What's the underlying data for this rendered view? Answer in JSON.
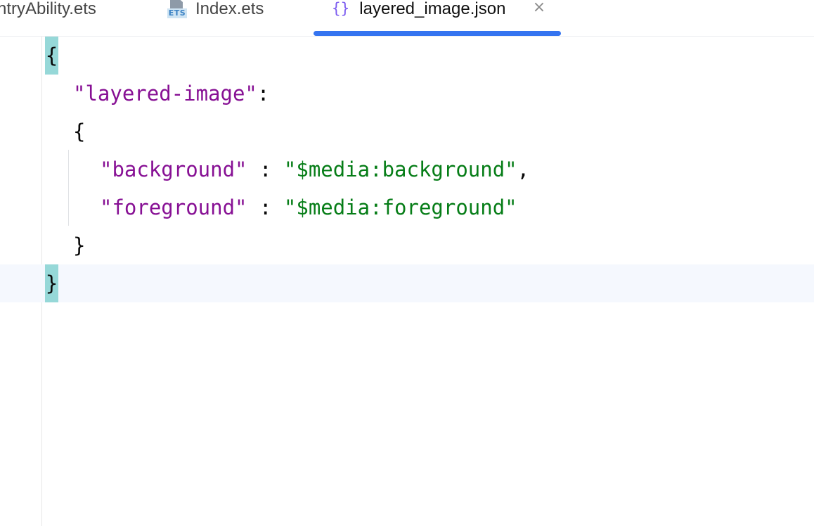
{
  "tabs": [
    {
      "label": "ntryAbility.ets",
      "active": false
    },
    {
      "label": "Index.ets",
      "active": false,
      "icon": "ets-file-icon",
      "icon_text": "ETS"
    },
    {
      "label": "layered_image.json",
      "active": true,
      "icon": "json-braces-icon",
      "icon_text": "{}"
    }
  ],
  "close_symbol": "×",
  "colors": {
    "active_tab_underline": "#3574f0",
    "json_key": "#871094",
    "json_string": "#067d17",
    "brace_highlight": "#96d8d8",
    "current_line": "#f5f8fe"
  },
  "editor": {
    "lines": [
      {
        "open_brace": "{"
      },
      {
        "key": "\"layered-image\"",
        "colon": ":"
      },
      {
        "open_brace": "{"
      },
      {
        "key": "\"background\"",
        "sep": " : ",
        "value": "\"$media:background\"",
        "comma": ","
      },
      {
        "key": "\"foreground\"",
        "sep": " : ",
        "value": "\"$media:foreground\""
      },
      {
        "close_brace": "}"
      },
      {
        "close_brace": "}"
      }
    ]
  }
}
